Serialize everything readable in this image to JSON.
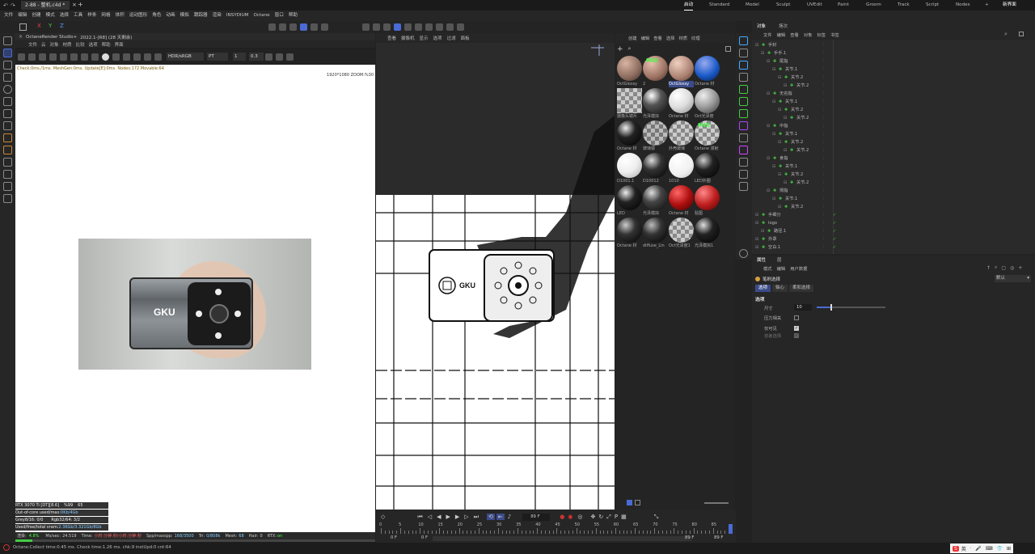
{
  "titlebar": {
    "tab": "2-88 - 整机.c4d *",
    "plus": "+"
  },
  "layouts": [
    "启动",
    "Standard",
    "Model",
    "Sculpt",
    "UVEdit",
    "Paint",
    "Groom",
    "Track",
    "Script",
    "Nodes"
  ],
  "new_layout": "新界面",
  "menu": [
    "文件",
    "编辑",
    "创建",
    "模式",
    "选择",
    "工具",
    "样条",
    "网格",
    "体积",
    "运动图形",
    "角色",
    "动画",
    "模拟",
    "跟踪器",
    "渲染",
    "INSYDIUM",
    "Octane",
    "窗口",
    "帮助"
  ],
  "axis_buttons": [
    "X",
    "Y",
    "Z"
  ],
  "octane": {
    "title": "OctaneRender Studio+",
    "version": "2022.1-[R8] (28 天剩余)",
    "menu": [
      "文件",
      "云",
      "对象",
      "材质",
      "比较",
      "选项",
      "帮助",
      "界面"
    ],
    "color_mode": "HDR/sRGB",
    "kernel": "PT",
    "frame": "1",
    "scale": "0.3",
    "status_line": "Check:0ms./1ms. MeshGen:0ms. Update[E]:0ms. Nodes:172 Movable:64",
    "resolution": "1920*1080 ZOOM:%30",
    "stats": [
      {
        "label": "RTX 3070 Ti [DT][8.6]",
        "v1": "%99",
        "v2": "65"
      },
      {
        "label": "Out-of-core used/max:",
        "v1": "0Kb/4Gb",
        "v2": ""
      },
      {
        "label": "Grey8/16: 0/0",
        "v1": "Rgb32/64: 3/2",
        "v2": ""
      },
      {
        "label": "Used/free/total vram:",
        "v1": "2.36Gb/3.321Gb/8Gb",
        "v2": ""
      }
    ],
    "progress_label": "渲染:",
    "progress": "4.8%",
    "mssec_label": "Ms/sec:",
    "mssec": "24.519",
    "time_label": "Time:",
    "time": "小时:分钟:秒/小时:分钟:秒",
    "spp_label": "Spp/maxspp:",
    "spp": "168/3500",
    "tri_label": "Tri:",
    "tri": "0/808k",
    "mesh_label": "Mesh:",
    "mesh": "68",
    "hair_label": "Hair:",
    "hair": "0",
    "rtx_label": "RTX:",
    "rtx": "on"
  },
  "viewport": {
    "menu": [
      "查看",
      "摄像机",
      "显示",
      "选项",
      "过滤",
      "面板"
    ]
  },
  "product_text": "GKU",
  "materials": {
    "menu": [
      "创建",
      "编辑",
      "查看",
      "选择",
      "材质",
      "纹理"
    ],
    "items": [
      "OctGlossy",
      "2",
      "OctGlossy",
      "Octane 材",
      "摄像头镜片",
      "光泽模拟",
      "Octane 材",
      "Oct光泽度",
      "Octane 材",
      "玻璃镜",
      "外壳玻璃",
      "Octane 漫射",
      "D1001.1",
      "D10012",
      "1010",
      "LED外圈",
      "LED",
      "光泽模拟",
      "Octane 材",
      "贴图",
      "Octane 材",
      "diffuse_Lin",
      "Oct光泽度1",
      "光泽模拟1"
    ],
    "mix_label": "MIX"
  },
  "object_manager": {
    "tabs": [
      "对象",
      "场次"
    ],
    "menu": [
      "文件",
      "编辑",
      "查看",
      "对象",
      "标签",
      "书签"
    ],
    "items": [
      {
        "name": "手封",
        "level": 0
      },
      {
        "name": "手手.1",
        "level": 1
      },
      {
        "name": "尾指",
        "level": 2
      },
      {
        "name": "关节.1",
        "level": 3
      },
      {
        "name": "关节.2",
        "level": 4
      },
      {
        "name": "关节.2",
        "level": 5
      },
      {
        "name": "无名指",
        "level": 2
      },
      {
        "name": "关节.1",
        "level": 3
      },
      {
        "name": "关节.2",
        "level": 4
      },
      {
        "name": "关节.2",
        "level": 5
      },
      {
        "name": "中指",
        "level": 2
      },
      {
        "name": "关节.1",
        "level": 3
      },
      {
        "name": "关节.2",
        "level": 4
      },
      {
        "name": "关节.2",
        "level": 5
      },
      {
        "name": "食指",
        "level": 2
      },
      {
        "name": "关节.1",
        "level": 3
      },
      {
        "name": "关节.2",
        "level": 4
      },
      {
        "name": "关节.2",
        "level": 5
      },
      {
        "name": "拇指",
        "level": 2
      },
      {
        "name": "关节.1",
        "level": 3
      },
      {
        "name": "关节.2",
        "level": 4
      },
      {
        "name": "手细分",
        "level": 0
      },
      {
        "name": "logo",
        "level": 0
      },
      {
        "name": "路径.1",
        "level": 1
      },
      {
        "name": "外罩",
        "level": 0
      },
      {
        "name": "空白.1",
        "level": 0
      }
    ]
  },
  "attributes": {
    "tabs": [
      "属性",
      "层"
    ],
    "menu": [
      "模式",
      "编辑",
      "用户数据"
    ],
    "tool_name": "笔刷选择",
    "preset": "默认",
    "subtabs": [
      "选项",
      "轴心",
      "柔和选择"
    ],
    "section": "选项",
    "size_label": "尺寸",
    "size_value": "10",
    "size_level": 0.2,
    "checks": [
      {
        "label": "压力相关",
        "checked": false
      },
      {
        "label": "仅可见",
        "checked": true
      },
      {
        "label": "容差选择",
        "checked": true
      }
    ]
  },
  "timeline": {
    "frame_field": "89 F",
    "ticks": [
      "0",
      "5",
      "10",
      "15",
      "20",
      "25",
      "30",
      "35",
      "40",
      "45",
      "50",
      "55",
      "60",
      "65",
      "70",
      "75",
      "80",
      "85"
    ],
    "start": "0 F",
    "start2": "0 F",
    "end": "89 F",
    "end2": "89 F"
  },
  "statusbar": {
    "text": "Octane:Collect time:0.45 ms.  Check time:1.26 ms.  chk:9  instUpd:0  cnt:64",
    "ime": "英"
  }
}
